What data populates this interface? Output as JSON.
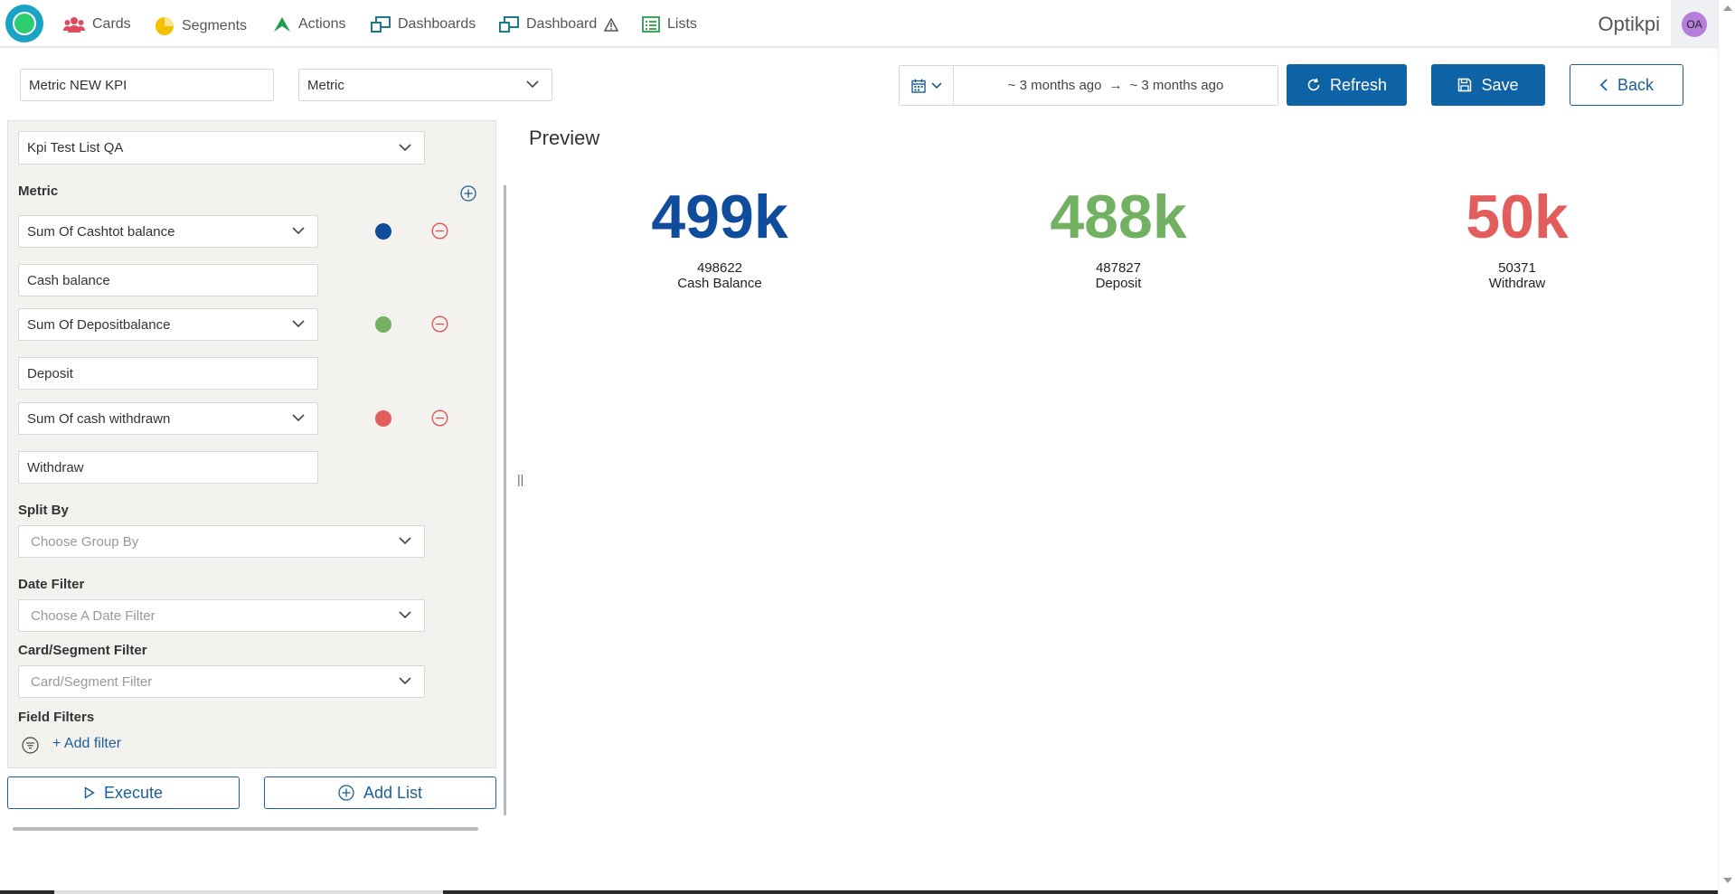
{
  "nav": {
    "items": [
      {
        "label": "Cards",
        "icon": "users-icon",
        "color": "#e04b5f"
      },
      {
        "label": "Segments",
        "icon": "pie-chart-icon",
        "color": "#f2c200"
      },
      {
        "label": "Actions",
        "icon": "actions-icon",
        "color": "#1e9e4a"
      },
      {
        "label": "Dashboards",
        "icon": "dashboard-icon",
        "color": "#1c7a8c"
      },
      {
        "label": "Dashboard",
        "icon": "dashboard-icon",
        "color": "#1c7a8c"
      },
      {
        "label": "Lists",
        "icon": "list-icon",
        "color": "#2a9d4a"
      }
    ],
    "brand": "Optikpi",
    "avatar": "OA"
  },
  "toolbar": {
    "name_value": "Metric NEW KPI",
    "type_value": "Metric",
    "date_from": "~ 3 months ago",
    "date_arrow": "→",
    "date_to": "~ 3 months ago",
    "refresh_label": "Refresh",
    "save_label": "Save",
    "back_label": "Back"
  },
  "sidebar": {
    "list_value": "Kpi Test List QA",
    "metric_label": "Metric",
    "metrics": [
      {
        "aggregate": "Sum Of Cashtot balance",
        "alias": "Cash balance",
        "color": "#0f4c9c"
      },
      {
        "aggregate": "Sum Of Depositbalance",
        "alias": "Deposit",
        "color": "#72b062"
      },
      {
        "aggregate": "Sum Of cash withdrawn",
        "alias": "Withdraw",
        "color": "#e35d5d"
      }
    ],
    "split_by_label": "Split By",
    "split_by_placeholder": "Choose Group By",
    "date_filter_label": "Date Filter",
    "date_filter_placeholder": "Choose A Date Filter",
    "card_filter_label": "Card/Segment Filter",
    "card_filter_placeholder": "Card/Segment Filter",
    "field_filters_label": "Field Filters",
    "add_filter_label": "+ Add filter",
    "execute_label": "Execute",
    "add_list_label": "Add List"
  },
  "preview": {
    "title": "Preview",
    "splitter": "||",
    "kpis": [
      {
        "display": "499k",
        "raw": "498622",
        "label": "Cash Balance",
        "color": "#0f4c9c"
      },
      {
        "display": "488k",
        "raw": "487827",
        "label": "Deposit",
        "color": "#72b062"
      },
      {
        "display": "50k",
        "raw": "50371",
        "label": "Withdraw",
        "color": "#e35d5d"
      }
    ]
  }
}
